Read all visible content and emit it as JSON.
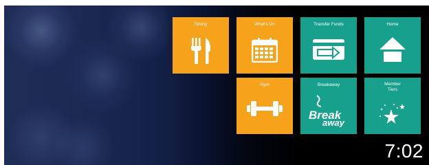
{
  "tiles": {
    "dining": {
      "label": "Dining",
      "icon": "fork-knife-icon"
    },
    "whats_on": {
      "label": "What's On",
      "icon": "calendar-icon"
    },
    "transfer_funds": {
      "label": "Transfer Funds",
      "icon": "card-transfer-icon"
    },
    "home": {
      "label": "Home",
      "icon": "house-icon"
    },
    "gym": {
      "label": "Gym",
      "icon": "dumbbell-icon"
    },
    "breakaway": {
      "label": "Breakaway",
      "logo_text": "Breakaway",
      "icon": "breakaway-logo"
    },
    "member_tiers": {
      "label": "Member Tiers",
      "icon": "stars-icon"
    }
  },
  "clock": {
    "time": "7:02"
  },
  "colors": {
    "orange": "#f7a21b",
    "teal": "#17a08b"
  }
}
